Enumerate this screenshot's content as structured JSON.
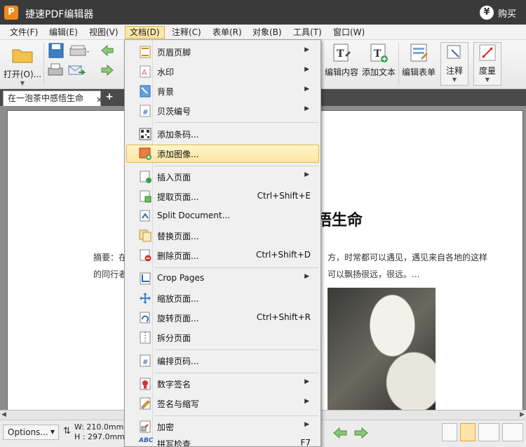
{
  "app": {
    "logo_letter": "P",
    "title": "捷速PDF编辑器",
    "buy_label": "购买",
    "buy_icon": "yen-icon"
  },
  "menubar": [
    {
      "label": "文件(F)"
    },
    {
      "label": "编辑(E)"
    },
    {
      "label": "视图(V)"
    },
    {
      "label": "文档(D)"
    },
    {
      "label": "注释(C)"
    },
    {
      "label": "表单(R)"
    },
    {
      "label": "对象(B)"
    },
    {
      "label": "工具(T)"
    },
    {
      "label": "窗口(W)"
    }
  ],
  "toolbar": {
    "open_label": "打开(O)...",
    "edit_content_label": "编辑内容",
    "add_text_label": "添加文本",
    "edit_form_label": "编辑表单",
    "comment_label": "注释",
    "measure_label": "度量"
  },
  "tab": {
    "title": "在一泡茶中感悟生命",
    "close": "✕",
    "add": "+"
  },
  "document": {
    "heading_tail": "悟生命",
    "line1_left": "摘要：在",
    "line1_right": "方，时常都可以遇见，遇见来自各地的这样",
    "line2_left": "的同行者",
    "line2_right": "可以飘扬很远，很远。..."
  },
  "statusbar": {
    "options_label": "Options...",
    "width_text": "W: 210.0mm",
    "height_text": "H : 297.0mm"
  },
  "menu": {
    "items": [
      {
        "label": "页眉页脚",
        "shortcut": "",
        "submenu": true,
        "icon": "header-footer-icon"
      },
      {
        "label": "水印",
        "shortcut": "",
        "submenu": true,
        "icon": "watermark-icon"
      },
      {
        "label": "背景",
        "shortcut": "",
        "submenu": true,
        "icon": "background-icon"
      },
      {
        "label": "贝茨编号",
        "shortcut": "",
        "submenu": true,
        "icon": "bates-number-icon"
      },
      {
        "label": "添加条码...",
        "shortcut": "",
        "submenu": false,
        "icon": "barcode-icon"
      },
      {
        "label": "添加图像...",
        "shortcut": "",
        "submenu": false,
        "icon": "add-image-icon"
      },
      {
        "label": "插入页面",
        "shortcut": "",
        "submenu": true,
        "icon": "insert-page-icon"
      },
      {
        "label": "提取页面...",
        "shortcut": "Ctrl+Shift+E",
        "submenu": false,
        "icon": "extract-page-icon"
      },
      {
        "label": "Split Document...",
        "shortcut": "",
        "submenu": false,
        "icon": "split-document-icon"
      },
      {
        "label": "替换页面...",
        "shortcut": "",
        "submenu": false,
        "icon": "replace-page-icon"
      },
      {
        "label": "删除页面...",
        "shortcut": "Ctrl+Shift+D",
        "submenu": false,
        "icon": "delete-page-icon"
      },
      {
        "label": "Crop Pages",
        "shortcut": "",
        "submenu": true,
        "icon": "crop-pages-icon"
      },
      {
        "label": "缩放页面...",
        "shortcut": "",
        "submenu": false,
        "icon": "resize-page-icon"
      },
      {
        "label": "旋转页面...",
        "shortcut": "Ctrl+Shift+R",
        "submenu": false,
        "icon": "rotate-page-icon"
      },
      {
        "label": "拆分页面",
        "shortcut": "",
        "submenu": false,
        "icon": "split-page-icon"
      },
      {
        "label": "编排页码...",
        "shortcut": "",
        "submenu": false,
        "icon": "page-numbering-icon"
      },
      {
        "label": "数字签名",
        "shortcut": "",
        "submenu": true,
        "icon": "digital-signature-icon"
      },
      {
        "label": "签名与缩写",
        "shortcut": "",
        "submenu": true,
        "icon": "sign-initial-icon"
      },
      {
        "label": "加密",
        "shortcut": "",
        "submenu": true,
        "icon": "encrypt-icon"
      },
      {
        "label": "拼写检查",
        "shortcut": "F7",
        "submenu": false,
        "icon": "spell-check-icon"
      }
    ],
    "arrow_glyph": "▶",
    "spell_icon_text": "ABC"
  },
  "colors": {
    "titlebar": "#3a3a3a",
    "accent_logo": "#f08a1c",
    "menu_highlight": "#fde7a0"
  }
}
